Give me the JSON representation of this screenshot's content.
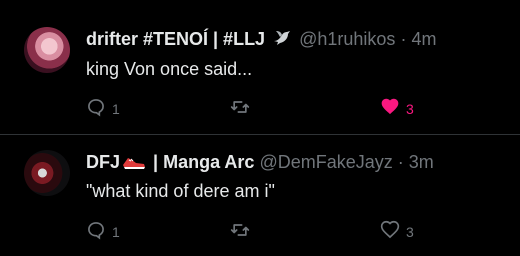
{
  "tweets": [
    {
      "display_name": "drifter #TENOÍ | #LLJ",
      "name_emoji": "dove",
      "handle": "@h1ruhikos",
      "separator": "·",
      "time": "4m",
      "text": "king Von once said...",
      "replies": "1",
      "retweets": "",
      "likes": "3",
      "liked": true
    },
    {
      "display_name_prefix": "DFJ",
      "name_emoji": "sneaker",
      "display_name_suffix": "| Manga Arc",
      "handle": "@DemFakeJayz",
      "separator": "·",
      "time": "3m",
      "text": "\"what kind of dere am i\"",
      "replies": "1",
      "retweets": "",
      "likes": "3",
      "liked": false
    }
  ],
  "colors": {
    "background": "#000000",
    "text": "#e7e9ea",
    "muted": "#71767b",
    "like_active": "#f91880",
    "divider": "#2f3336"
  }
}
